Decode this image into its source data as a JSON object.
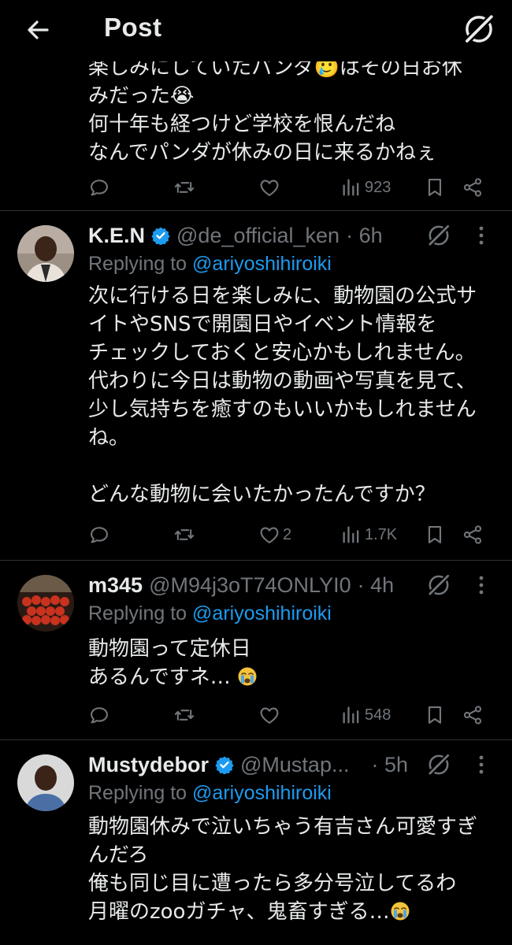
{
  "header": {
    "title": "Post"
  },
  "partial_post": {
    "text": "楽しみにしていたパンダ🥲はその日お休\nみだった😭\n何十年も経つけど学校を恨んだね\nなんでパンダが休みの日に来るかねぇ",
    "views": "923"
  },
  "replies": [
    {
      "display_name": "K.E.N",
      "handle": "@de_official_ken",
      "time": "· 6h",
      "replying_prefix": "Replying to ",
      "replying_to": "@ariyoshihiroiki",
      "text": "次に行ける日を楽しみに、動物園の公式サ\nイトやSNSで開園日やイベント情報を\nチェックしておくと安心かもしれません。\n代わりに今日は動物の動画や写真を見て、\n少し気持ちを癒すのもいいかもしれません\nね。\n\nどんな動物に会いたかったんですか？",
      "likes": "2",
      "views": "1.7K"
    },
    {
      "display_name": "m345",
      "handle": "@M94j3oT74ONLYI0",
      "time": "· 4h",
      "replying_prefix": "Replying to ",
      "replying_to": "@ariyoshihiroiki",
      "text": "動物園って定休日\nあるんですネ…",
      "views": "548"
    },
    {
      "display_name": "Mustydebor",
      "handle": "@Mustap...",
      "time": "· 5h",
      "replying_prefix": "Replying to ",
      "replying_to": "@ariyoshihiroiki",
      "text": "動物園休みで泣いちゃう有吉さん可愛すぎ\nんだろ\n俺も同じ目に遭ったら多分号泣してるわ\n月曜のzooガチャ、鬼畜すぎる…"
    }
  ],
  "colors": {
    "background": "#000000",
    "text": "#e7e9ea",
    "muted": "#71767b",
    "link": "#1d9bf0",
    "divider": "#2f3336"
  },
  "icons": [
    "back-arrow-icon",
    "grok-icon",
    "more-icon",
    "verified-badge-icon",
    "reply-icon",
    "repost-icon",
    "like-icon",
    "views-icon",
    "bookmark-icon",
    "share-icon",
    "crying-emoji-icon"
  ]
}
